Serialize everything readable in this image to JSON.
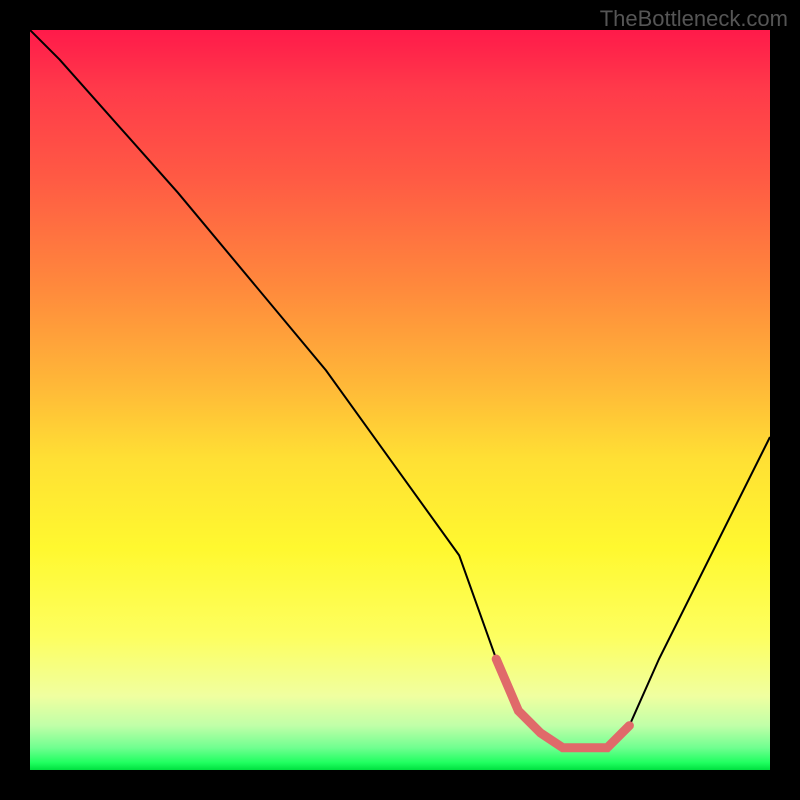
{
  "watermark": "TheBottleneck.com",
  "chart_data": {
    "type": "line",
    "title": "",
    "xlabel": "",
    "ylabel": "",
    "xlim": [
      0,
      100
    ],
    "ylim": [
      0,
      100
    ],
    "series": [
      {
        "name": "main-curve",
        "color": "#000000",
        "x": [
          0,
          4,
          20,
          40,
          58,
          63,
          66,
          72,
          78,
          81,
          85,
          100
        ],
        "y": [
          100,
          96,
          78,
          54,
          29,
          15,
          8,
          3,
          3,
          6,
          15,
          45
        ]
      },
      {
        "name": "highlight-segment",
        "color": "#e06a6a",
        "thick": true,
        "x": [
          63,
          66,
          69,
          72,
          75,
          78,
          81
        ],
        "y": [
          15,
          8,
          5,
          3,
          3,
          3,
          6
        ]
      }
    ],
    "gradient_stops": [
      {
        "pos": 0,
        "color": "#ff1a4a"
      },
      {
        "pos": 100,
        "color": "#00e040"
      }
    ]
  }
}
